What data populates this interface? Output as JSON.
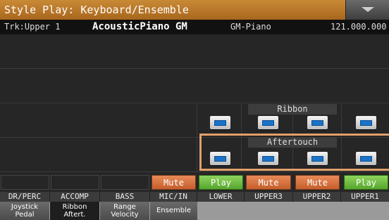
{
  "titlebar": {
    "title": "Style Play: Keyboard/Ensemble"
  },
  "track": {
    "label": "Trk:Upper 1",
    "sound_name": "AcousticPiano GM",
    "sound_category": "GM-Piano",
    "sound_id": "121.000.000"
  },
  "sections": {
    "ribbon": "Ribbon",
    "aftertouch": "Aftertouch"
  },
  "track_states": [
    {
      "channel": "MIC/IN",
      "state": "Mute"
    },
    {
      "channel": "LOWER",
      "state": "Play"
    },
    {
      "channel": "UPPER3",
      "state": "Mute"
    },
    {
      "channel": "UPPER2",
      "state": "Mute"
    },
    {
      "channel": "UPPER1",
      "state": "Play"
    }
  ],
  "channels": [
    "DR/PERC",
    "ACCOMP",
    "BASS",
    "MIC/IN",
    "LOWER",
    "UPPER3",
    "UPPER2",
    "UPPER1"
  ],
  "tabs": [
    {
      "line1": "Joystick",
      "line2": "Pedal"
    },
    {
      "line1": "Ribbon",
      "line2": "Aftert."
    },
    {
      "line1": "Range",
      "line2": "Velocity"
    },
    {
      "line1": "Ensemble",
      "line2": ""
    }
  ],
  "colors": {
    "title_bar": "#b5732a",
    "mute": "#d9703d",
    "play": "#6fbf3f",
    "led": "#1a73c8",
    "highlight": "#e2a06a"
  }
}
